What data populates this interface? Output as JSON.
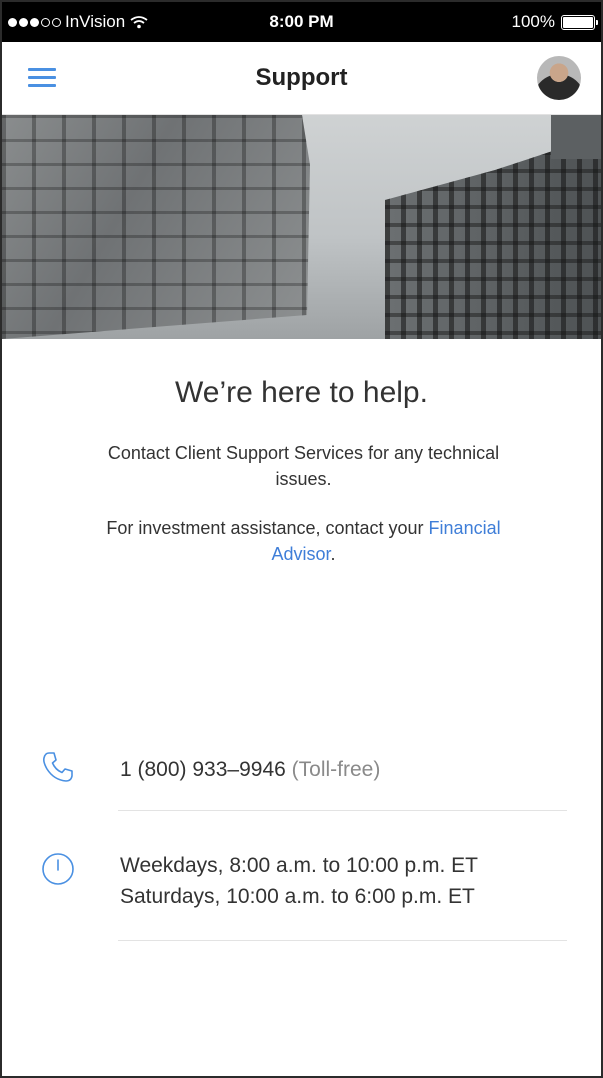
{
  "status_bar": {
    "carrier": "InVision",
    "time": "8:00 PM",
    "battery_label": "100%",
    "battery_level": 1.0,
    "signal_bars_filled": 3,
    "signal_bars_total": 5,
    "icons": [
      "signal-dots-icon",
      "wifi-icon",
      "battery-icon"
    ]
  },
  "nav": {
    "title": "Support",
    "menu_icon": "hamburger-menu-icon",
    "avatar": "user-avatar"
  },
  "content": {
    "headline": "We’re here to help.",
    "paragraph1": "Contact Client Support Services for any technical issues.",
    "paragraph2_prefix": "For investment assistance, contact your ",
    "paragraph2_link": "Financial Advisor",
    "paragraph2_suffix": "."
  },
  "contact": {
    "phone_number": "1 (800) 933–9946",
    "phone_note": "(Toll-free)",
    "hours_line1": "Weekdays, 8:00 a.m. to 10:00 p.m. ET",
    "hours_line2": "Saturdays, 10:00 a.m. to 6:00 p.m. ET"
  },
  "colors": {
    "accent": "#4a90e2",
    "link": "#3f7ed8",
    "text": "#333333",
    "muted": "#8a8a8a"
  }
}
